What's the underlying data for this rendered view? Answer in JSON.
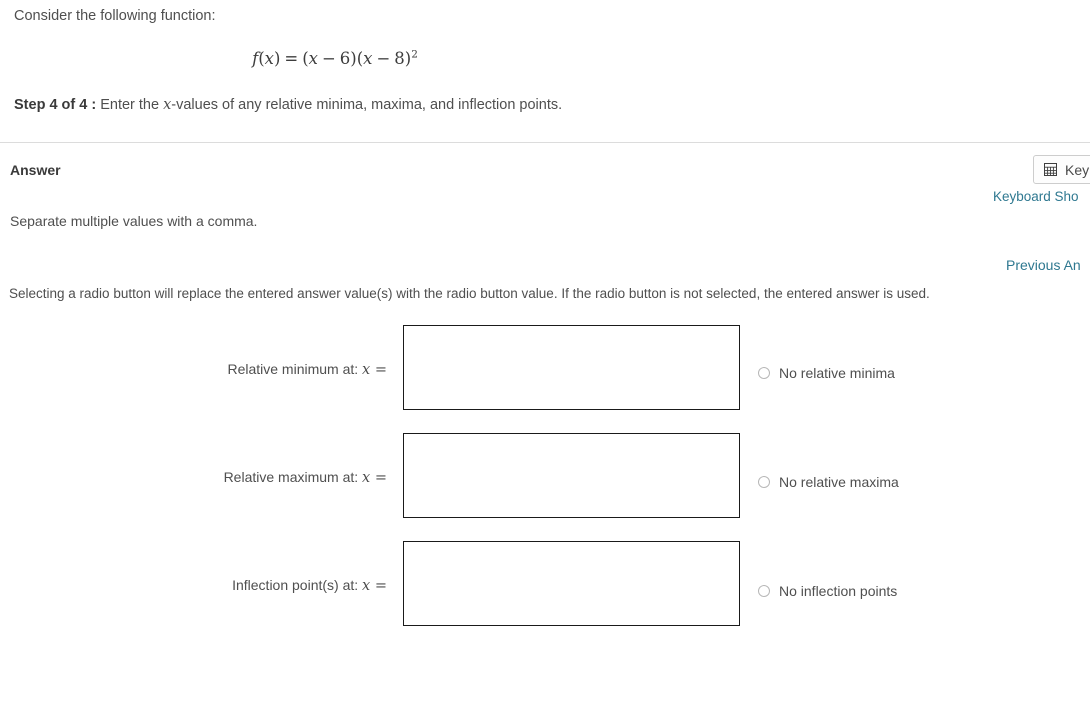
{
  "question": {
    "prompt": "Consider the following function:",
    "formula": {
      "fn_name": "f",
      "fn_arg": "x",
      "equals": "=",
      "factor1_open": "(",
      "factor1_var": "x",
      "factor1_op": "−",
      "factor1_num": "6",
      "factor1_close": ")",
      "factor2_open": "(",
      "factor2_var": "x",
      "factor2_op": "−",
      "factor2_num": "8",
      "factor2_close": ")",
      "exponent": "2",
      "plain": "f(x) = (x − 6)(x − 8)²"
    },
    "step_label": "Step 4 of 4 :",
    "step_text_before_var": "Enter the ",
    "step_var": "x",
    "step_text_after_var": "-values of any relative minima, maxima, and inflection points."
  },
  "answer_section": {
    "heading": "Answer",
    "keypad_button_label": "Key",
    "keypad_icon": "keypad-grid-icon",
    "keyboard_shortcuts_link": "Keyboard Sho",
    "separate_values_note": "Separate multiple values with a comma.",
    "previous_answers_link": "Previous An",
    "radio_note": "Selecting a radio button will replace the entered answer value(s) with the radio button value. If the radio button is not selected, the entered answer is used.",
    "rows": [
      {
        "label_text": "Relative minimum at: ",
        "label_var": "x",
        "label_equals": " =",
        "input_value": "",
        "input_placeholder": "",
        "radio_label": "No relative minima",
        "radio_selected": false
      },
      {
        "label_text": "Relative maximum at: ",
        "label_var": "x",
        "label_equals": " =",
        "input_value": "",
        "input_placeholder": "",
        "radio_label": "No relative maxima",
        "radio_selected": false
      },
      {
        "label_text": "Inflection point(s) at: ",
        "label_var": "x",
        "label_equals": " =",
        "input_value": "",
        "input_placeholder": "",
        "radio_label": "No inflection points",
        "radio_selected": false
      }
    ]
  },
  "colors": {
    "link": "#2e7890",
    "text": "#4f4f4f",
    "divider": "#dcdcdc",
    "input_border": "#1a1a1a",
    "radio_border": "#b7b7b7"
  }
}
